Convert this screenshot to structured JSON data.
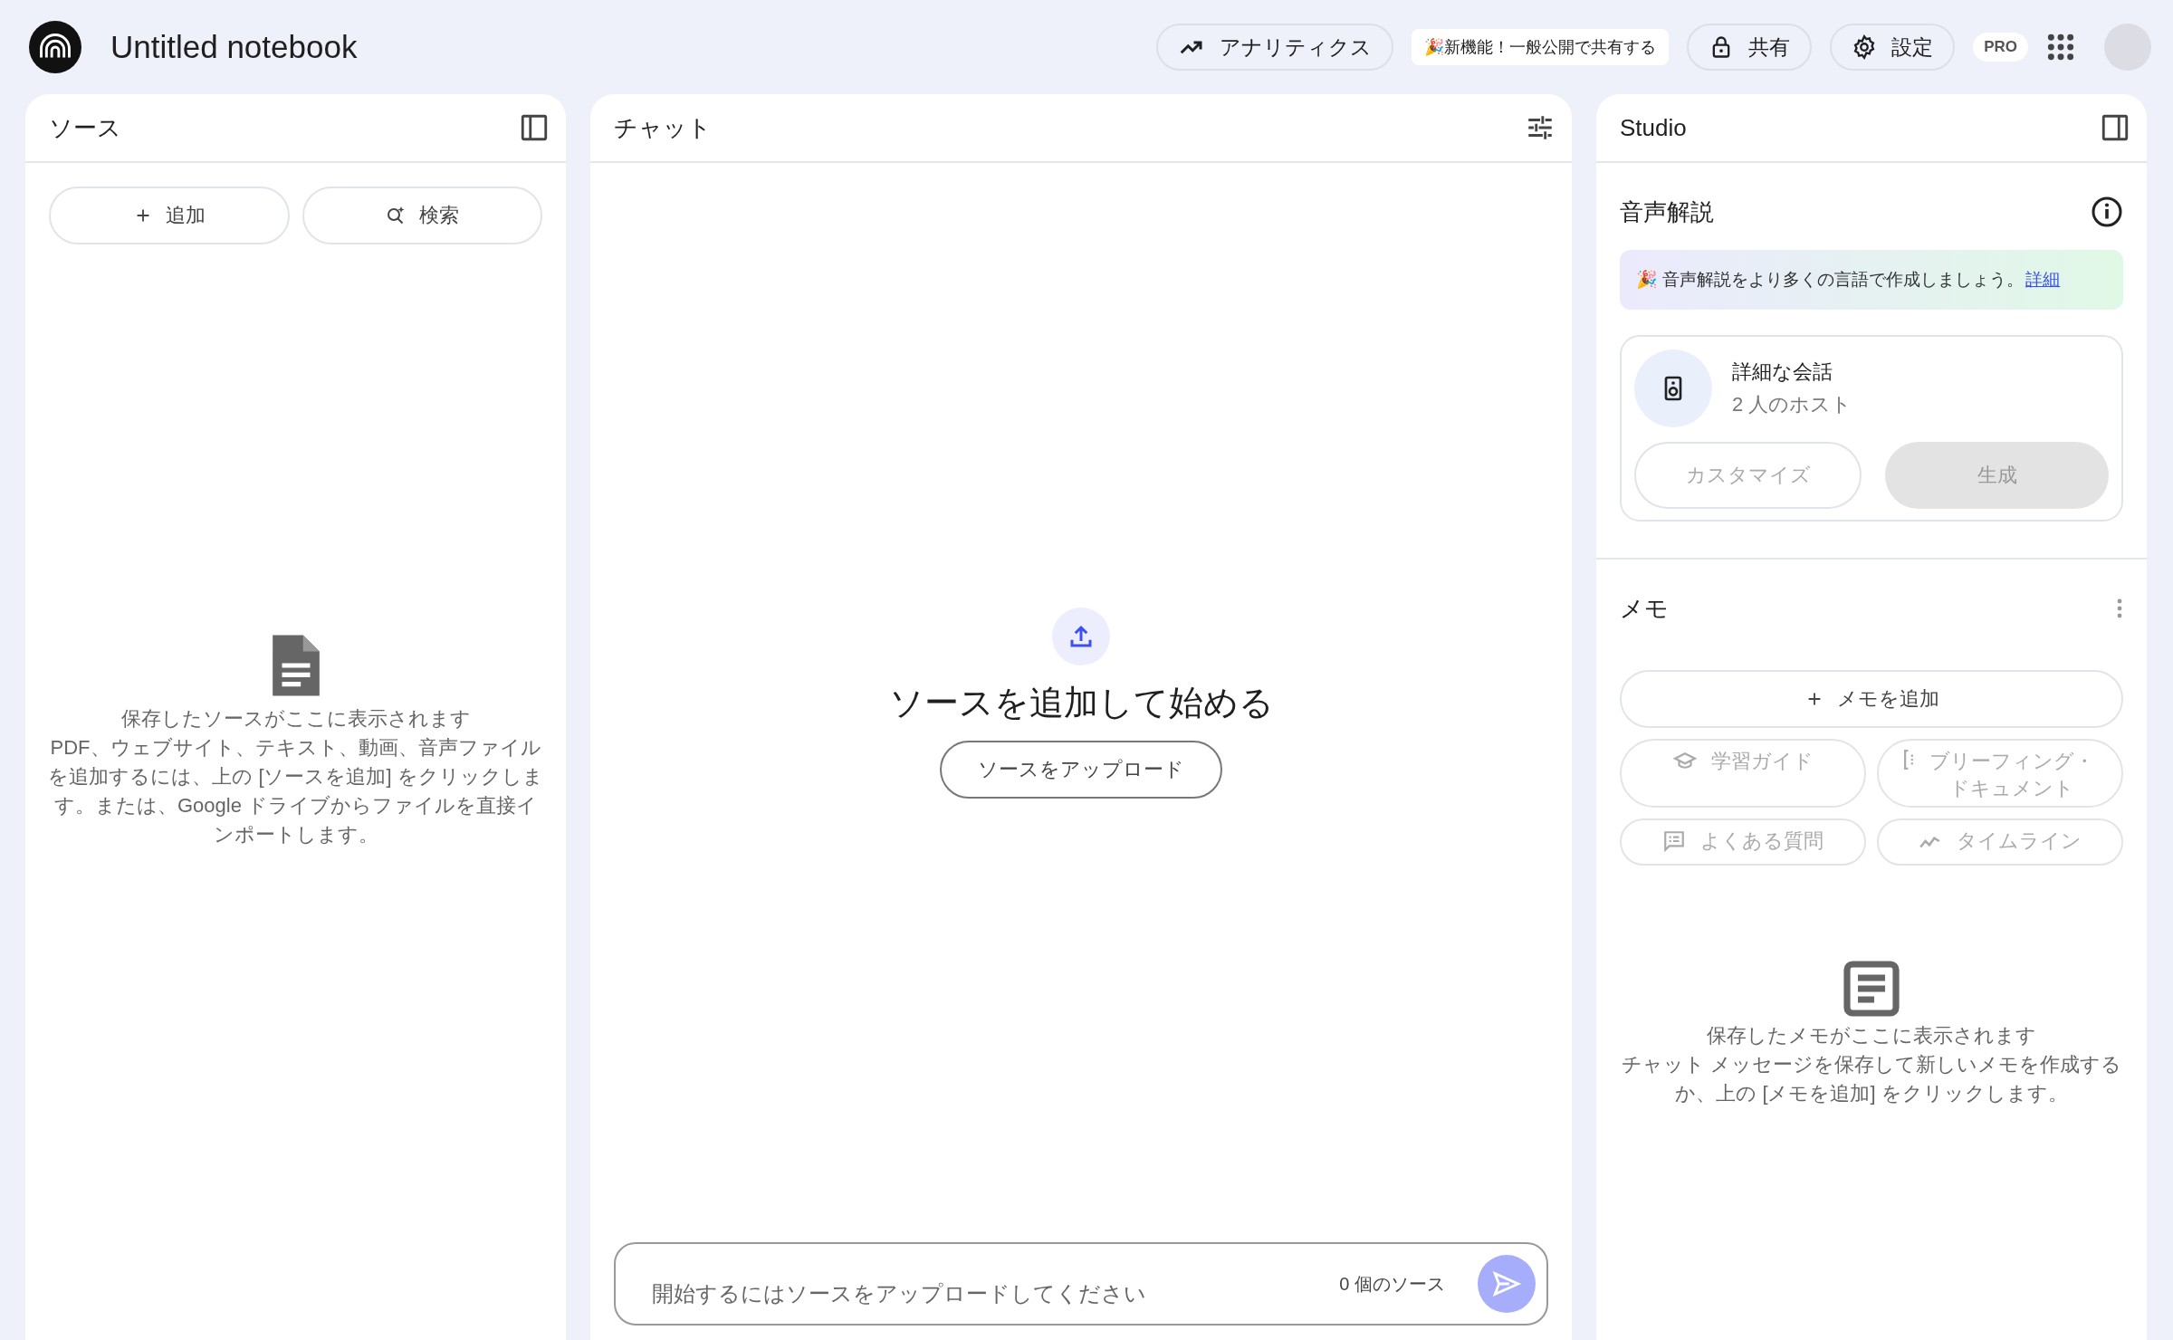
{
  "header": {
    "title": "Untitled notebook",
    "buttons": [
      {
        "kind": "analytics",
        "label": "アナリティクス"
      },
      {
        "kind": "promo",
        "label": "🎉新機能！一般公開で共有する"
      },
      {
        "kind": "share",
        "label": "共有"
      },
      {
        "kind": "settings",
        "label": "設定"
      }
    ],
    "badge": "PRO"
  },
  "sources": {
    "title": "ソース",
    "buttons": [
      {
        "kind": "add",
        "label": "追加"
      },
      {
        "kind": "search",
        "label": "検索"
      }
    ],
    "empty": {
      "title": "保存したソースがここに表示されます",
      "text": "PDF、ウェブサイト、テキスト、動画、音声ファイルを追加するには、上の [ソースを追加] をクリックします。または、Google ドライブからファイルを直接インポートします。"
    }
  },
  "chat": {
    "title": "チャット",
    "heading": "ソースを追加して始める",
    "upload_button": "ソースをアップロード",
    "input": {
      "placeholder": "開始するにはソースをアップロードしてください",
      "source_count": "0 個のソース",
      "send_disabled": true
    }
  },
  "studio": {
    "title": "Studio",
    "audio": {
      "title": "音声解説",
      "banner": {
        "text": "🎉 音声解説をより多くの言語で作成しましょう。",
        "link": "詳細"
      },
      "card": {
        "title": "詳細な会話",
        "subtitle": "2 人のホスト",
        "buttons": [
          {
            "kind": "outline",
            "label": "カスタマイズ",
            "disabled": true
          },
          {
            "kind": "filled",
            "label": "生成",
            "disabled": true
          }
        ]
      }
    },
    "notes": {
      "title": "メモ",
      "add_button": "メモを追加",
      "actions": [
        {
          "kind": "study",
          "label": "学習ガイド",
          "disabled": true
        },
        {
          "kind": "briefing",
          "label": "ブリーフィング・ドキュメント",
          "disabled": true
        },
        {
          "kind": "faq",
          "label": "よくある質問",
          "disabled": true
        },
        {
          "kind": "timeline",
          "label": "タイムライン",
          "disabled": true
        }
      ],
      "empty": {
        "title": "保存したメモがここに表示されます",
        "text": "チャット メッセージを保存して新しいメモを作成するか、上の [メモを追加] をクリックします。"
      }
    }
  }
}
